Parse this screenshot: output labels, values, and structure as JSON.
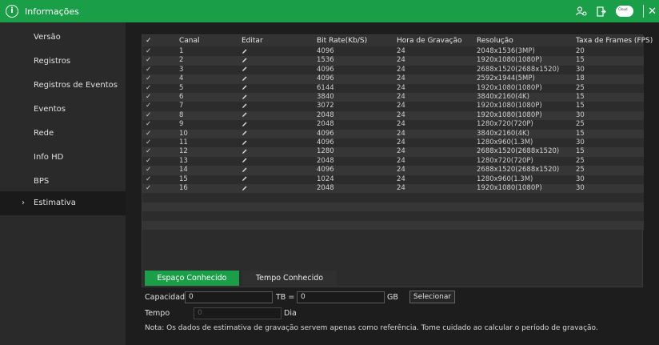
{
  "topbar": {
    "title": "Informações",
    "icons": [
      "info-icon",
      "user-settings-icon",
      "exit-icon",
      "cloud-icon",
      "close-icon"
    ],
    "cloud_text": "Cloud"
  },
  "sidebar": {
    "items": [
      {
        "label": "Versão"
      },
      {
        "label": "Registros"
      },
      {
        "label": "Registros de Eventos"
      },
      {
        "label": "Eventos"
      },
      {
        "label": "Rede"
      },
      {
        "label": "Info HD"
      },
      {
        "label": "BPS"
      },
      {
        "label": "Estimativa",
        "active": true
      }
    ]
  },
  "table": {
    "headers": {
      "check": "✓",
      "canal": "Canal",
      "editar": "Editar",
      "bitrate": "Bit Rate(Kb/S)",
      "hora": "Hora de Gravação",
      "resolucao": "Resolução",
      "fps": "Taxa de Frames (FPS)"
    },
    "rows": [
      {
        "canal": "1",
        "bitrate": "4096",
        "hora": "24",
        "resolucao": "2048x1536(3MP)",
        "fps": "20"
      },
      {
        "canal": "2",
        "bitrate": "1536",
        "hora": "24",
        "resolucao": "1920x1080(1080P)",
        "fps": "15"
      },
      {
        "canal": "3",
        "bitrate": "4096",
        "hora": "24",
        "resolucao": "2688x1520(2688x1520)",
        "fps": "30"
      },
      {
        "canal": "4",
        "bitrate": "4096",
        "hora": "24",
        "resolucao": "2592x1944(5MP)",
        "fps": "18"
      },
      {
        "canal": "5",
        "bitrate": "6144",
        "hora": "24",
        "resolucao": "1920x1080(1080P)",
        "fps": "25"
      },
      {
        "canal": "6",
        "bitrate": "3840",
        "hora": "24",
        "resolucao": "3840x2160(4K)",
        "fps": "15"
      },
      {
        "canal": "7",
        "bitrate": "3072",
        "hora": "24",
        "resolucao": "1920x1080(1080P)",
        "fps": "15"
      },
      {
        "canal": "8",
        "bitrate": "2048",
        "hora": "24",
        "resolucao": "1920x1080(1080P)",
        "fps": "30"
      },
      {
        "canal": "9",
        "bitrate": "2048",
        "hora": "24",
        "resolucao": "1280x720(720P)",
        "fps": "25"
      },
      {
        "canal": "10",
        "bitrate": "4096",
        "hora": "24",
        "resolucao": "3840x2160(4K)",
        "fps": "15"
      },
      {
        "canal": "11",
        "bitrate": "4096",
        "hora": "24",
        "resolucao": "1280x960(1.3M)",
        "fps": "30"
      },
      {
        "canal": "12",
        "bitrate": "1280",
        "hora": "24",
        "resolucao": "2688x1520(2688x1520)",
        "fps": "15"
      },
      {
        "canal": "13",
        "bitrate": "2048",
        "hora": "24",
        "resolucao": "1280x720(720P)",
        "fps": "25"
      },
      {
        "canal": "14",
        "bitrate": "4096",
        "hora": "24",
        "resolucao": "2688x1520(2688x1520)",
        "fps": "25"
      },
      {
        "canal": "15",
        "bitrate": "1024",
        "hora": "24",
        "resolucao": "1280x960(1.3M)",
        "fps": "30"
      },
      {
        "canal": "16",
        "bitrate": "2048",
        "hora": "24",
        "resolucao": "1920x1080(1080P)",
        "fps": "30"
      }
    ]
  },
  "tabs": {
    "known_space": "Espaço Conhecido",
    "known_time": "Tempo Conhecido"
  },
  "form": {
    "capacity_label": "Capacidade",
    "capacity_value": "0",
    "tb_label": "TB =",
    "tb_value": "0",
    "gb_label": "GB",
    "select_button": "Selecionar",
    "time_label": "Tempo",
    "time_value": "0",
    "day_label": "Dia"
  },
  "note": "Nota: Os dados de estimativa de gravação servem apenas como referência. Tome cuidado ao calcular o período de gravação.",
  "colors": {
    "accent": "#1a9e48",
    "sidebar_bg": "#2a2a2a",
    "main_bg": "#1d1d1d"
  }
}
